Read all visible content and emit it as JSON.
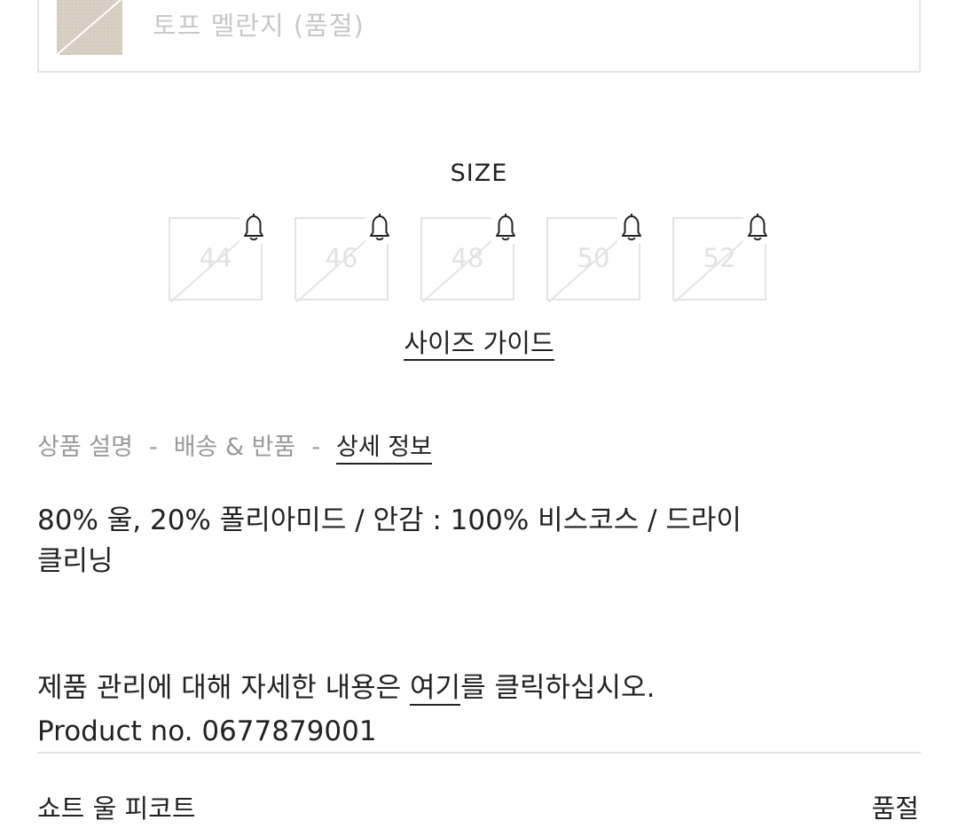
{
  "color": {
    "name": "토프 멜란지 (품절)",
    "swatch_color": "#d9d0c5"
  },
  "size_section": {
    "title": "SIZE",
    "sizes": [
      {
        "label": "44",
        "notify_icon": "bell-icon"
      },
      {
        "label": "46",
        "notify_icon": "bell-icon"
      },
      {
        "label": "48",
        "notify_icon": "bell-icon"
      },
      {
        "label": "50",
        "notify_icon": "bell-icon"
      },
      {
        "label": "52",
        "notify_icon": "bell-icon"
      }
    ],
    "guide_label": "사이즈 가이드"
  },
  "tabs": {
    "description": "상품 설명",
    "delivery": "배송 & 반품",
    "details": "상세 정보",
    "separator": "-"
  },
  "details": {
    "material_line1": "80% 울, 20% 폴리아미드 / 안감 : 100% 비스코스 / 드라이",
    "material_line2": "클리닝",
    "care_prefix": "제품 관리에 대해 자세한 내용은 ",
    "care_link": "여기",
    "care_suffix": "를 클릭하십시오.",
    "product_no": "Product no. 0677879001"
  },
  "product": {
    "name": "쇼트 울 피코트",
    "status": "품절"
  }
}
